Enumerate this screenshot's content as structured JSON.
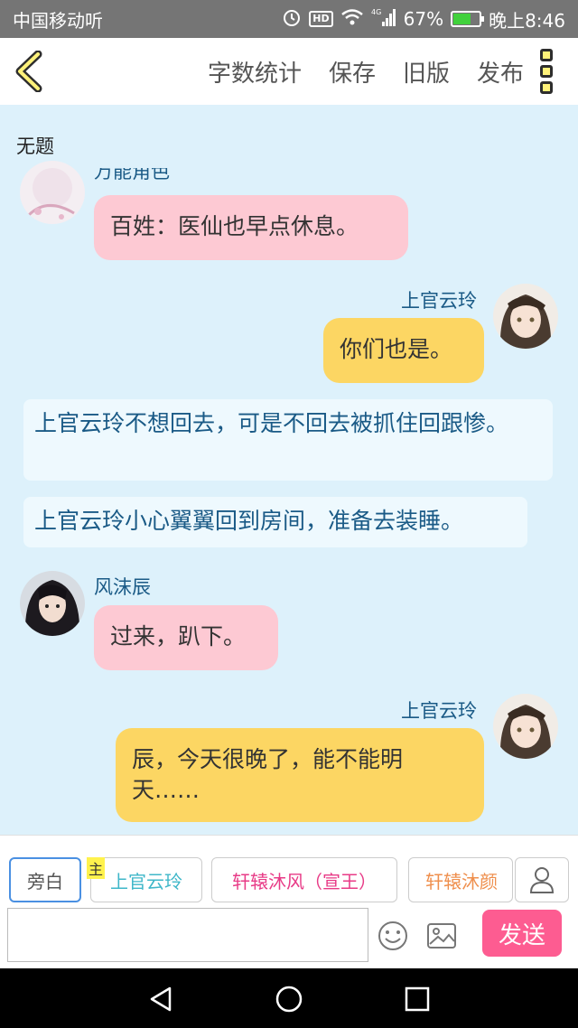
{
  "status_bar": {
    "carrier": "中国移动听",
    "network": "4G",
    "battery_percent": "67%",
    "battery_level": 0.67,
    "time": "晚上8:46"
  },
  "toolbar": {
    "word_count": "字数统计",
    "save": "保存",
    "old_version": "旧版",
    "publish": "发布"
  },
  "document": {
    "title": "无题"
  },
  "messages": {
    "m1": {
      "name": "万能角色",
      "text": "百姓：医仙也早点休息。"
    },
    "m2": {
      "name": "上官云玲",
      "text": "你们也是。"
    },
    "n1": {
      "text": "上官云玲不想回去，可是不回去被抓住回跟惨。"
    },
    "n2": {
      "text": "上官云玲小心翼翼回到房间，准备去装睡。"
    },
    "m3": {
      "name": "风沫辰",
      "text": "过来，趴下。"
    },
    "m4": {
      "name": "上官云玲",
      "text": "辰，今天很晚了，能不能明天……"
    }
  },
  "roles": {
    "narration": "旁白",
    "main_badge": "主",
    "r1": "上官云玲",
    "r2": "轩辕沐风（宣王）",
    "r3": "轩辕沐颜"
  },
  "composer": {
    "input_value": "",
    "send": "发送"
  },
  "colors": {
    "chat_bg": "#ddf1fb",
    "bubble_pink": "#fdc9d3",
    "bubble_yellow": "#fcd663",
    "send_button": "#fd5c91",
    "role_r1": "#3fb7c9",
    "role_r2": "#e83b87",
    "role_r3": "#ef8f4d"
  }
}
